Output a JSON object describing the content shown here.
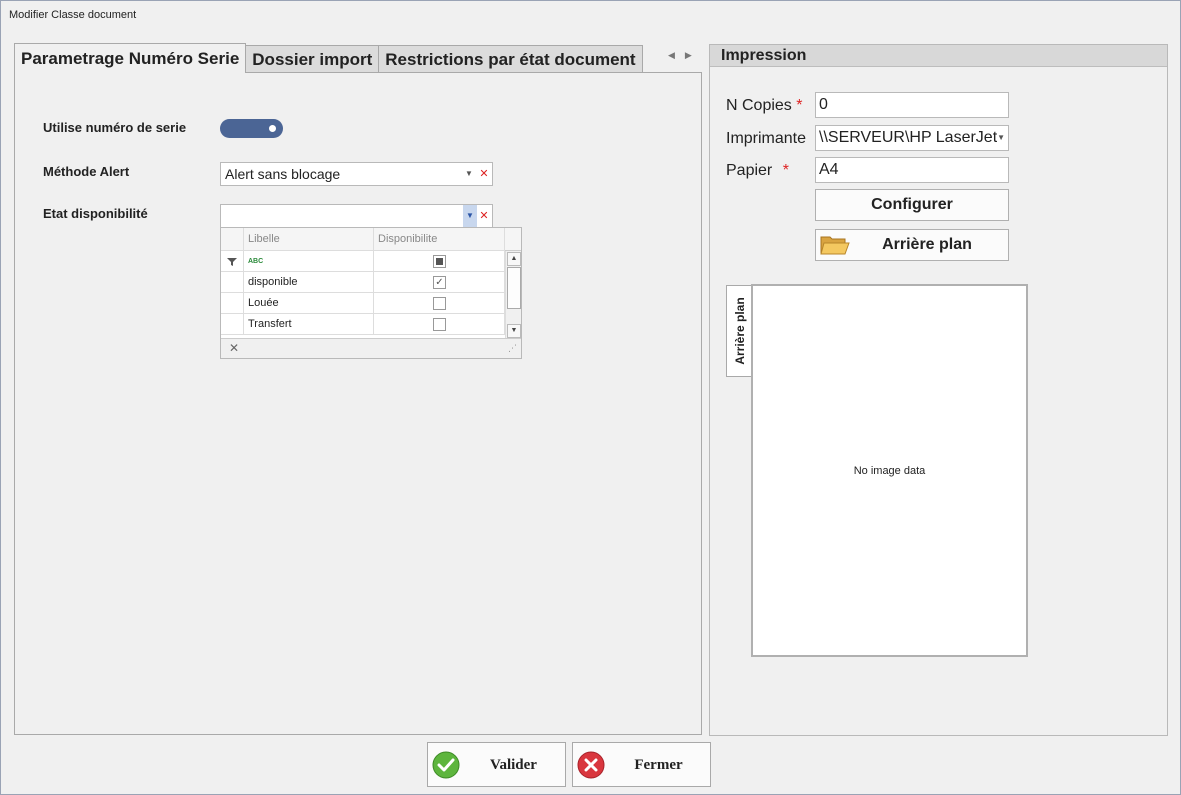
{
  "window": {
    "title": "Modifier Classe document"
  },
  "tabs": [
    {
      "label": "Parametrage Numéro Serie",
      "active": true
    },
    {
      "label": "Dossier import",
      "active": false
    },
    {
      "label": "Restrictions par état document",
      "active": false
    }
  ],
  "form": {
    "use_serial_label": "Utilise numéro de serie",
    "use_serial_on": true,
    "alert_method_label": "Méthode Alert",
    "alert_method_value": "Alert sans blocage",
    "availability_label": "Etat disponibilité",
    "availability_value": ""
  },
  "grid": {
    "columns": [
      "Libelle",
      "Disponibilite"
    ],
    "filter_text": "ABC",
    "rows": [
      {
        "libelle": "disponible",
        "checked": true
      },
      {
        "libelle": "Louée",
        "checked": false
      },
      {
        "libelle": "Transfert",
        "checked": false
      }
    ]
  },
  "impression": {
    "title": "Impression",
    "copies_label": "N Copies",
    "copies_value": "0",
    "printer_label": "Imprimante",
    "printer_value": "\\\\SERVEUR\\HP LaserJet",
    "paper_label": "Papier",
    "paper_value": "A4",
    "configure_label": "Configurer",
    "background_label": "Arrière plan",
    "preview_tab": "Arrière plan",
    "preview_empty": "No image data",
    "required_mark": "*"
  },
  "footer": {
    "validate_label": "Valider",
    "close_label": "Fermer"
  },
  "colors": {
    "toggle": "#4b6595",
    "required": "#dd2222",
    "validate_icon": "#5db53d",
    "close_icon": "#d9363e"
  }
}
